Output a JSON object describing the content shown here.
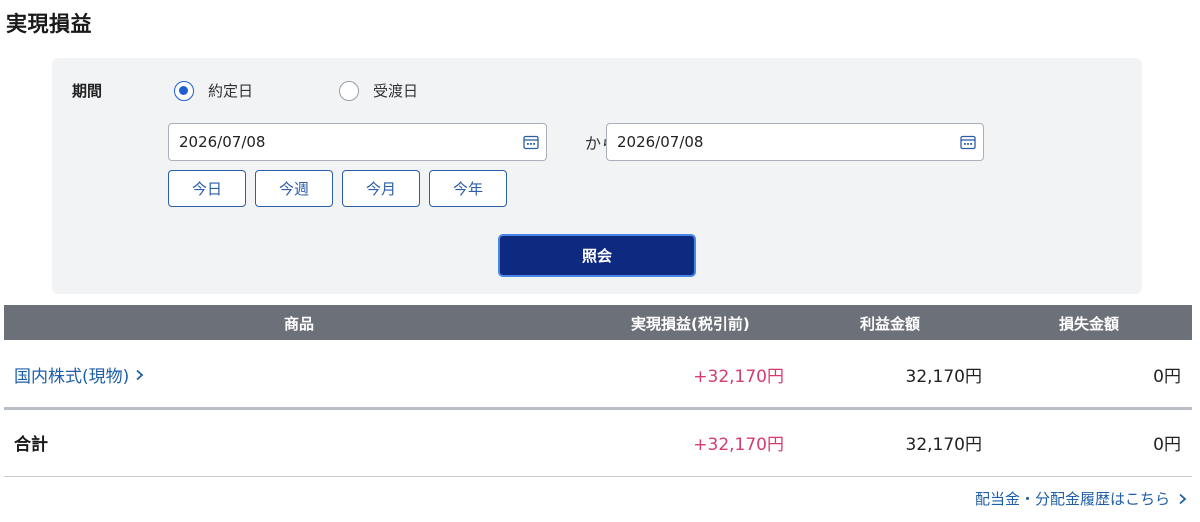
{
  "page": {
    "title": "実現損益"
  },
  "filter": {
    "period_label": "期間",
    "radios": [
      {
        "label": "約定日",
        "checked": true
      },
      {
        "label": "受渡日",
        "checked": false
      }
    ],
    "date_from": "2026/07/08",
    "date_to": "2026/07/08",
    "range_separator": "から",
    "quick_buttons": [
      "今日",
      "今週",
      "今月",
      "今年"
    ],
    "submit_label": "照会"
  },
  "table": {
    "headers": [
      "商品",
      "実現損益(税引前)",
      "利益金額",
      "損失金額"
    ],
    "rows": [
      {
        "product": "国内株式(現物)",
        "realized_pl": "+32,170円",
        "profit": "32,170円",
        "loss": "0円"
      }
    ],
    "total": {
      "label": "合計",
      "realized_pl": "+32,170円",
      "profit": "32,170円",
      "loss": "0円"
    }
  },
  "footer": {
    "dividend_link": "配当金・分配金履歴はこちら"
  },
  "colors": {
    "accent": "#1f5fd0",
    "submit_bg": "#0d2a80",
    "header_bg": "#6b7079",
    "gain": "#d63c6e",
    "link": "#1f5fa8"
  },
  "icons": {
    "calendar": "calendar-icon",
    "chevron": "chevron-right-icon"
  }
}
